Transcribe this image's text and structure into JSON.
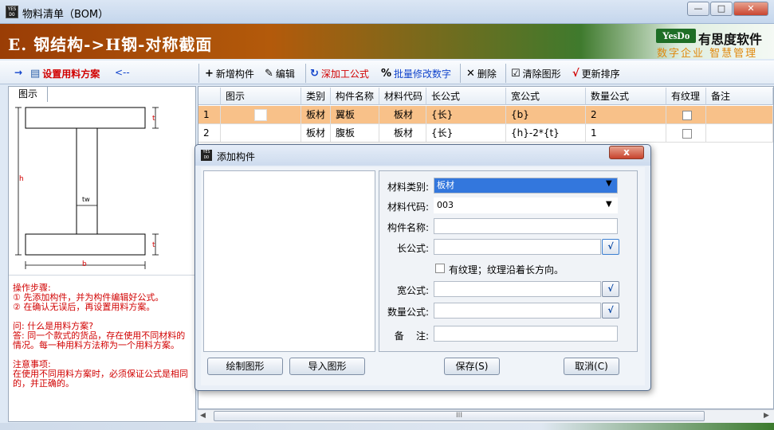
{
  "window": {
    "title": "物料清单（BOM）",
    "icon_text": "YES DO"
  },
  "banner": {
    "title": "E. 钢结构->H钢-对称截面",
    "logo_badge": "YesDo",
    "logo_name": "有思度软件",
    "logo_slogan": "数字企业 智慧管理"
  },
  "toolbar": {
    "arrow_left": "→",
    "setup_plan": "设置用料方案",
    "arrow_back": "<--",
    "add_component": "新增构件",
    "edit": "编辑",
    "add_process_formula": "深加工公式",
    "batch_modify": "批量修改数字",
    "delete": "删除",
    "clear_drawing": "清除图形",
    "reorder": "更新排序"
  },
  "left_panel": {
    "tab": "图示",
    "dim_t": "t",
    "dim_h": "h",
    "dim_tw": "tw",
    "dim_b": "b",
    "steps_title": "操作步骤:",
    "step1": "① 先添加构件，并为构件编辑好公式。",
    "step2": "② 在确认无误后，再设置用料方案。",
    "q_title": "问: 什么是用料方案?",
    "q_answer": "答: 同一个款式的货品，存在使用不同材料的情况。每一种用料方法称为一个用料方案。",
    "note_title": "注意事项:",
    "note_text": "在使用不同用料方案时，必须保证公式是相同的，并正确的。"
  },
  "grid": {
    "headers": [
      "图示",
      "类别",
      "构件名称",
      "材料代码",
      "长公式",
      "宽公式",
      "数量公式",
      "有纹理",
      "备注"
    ],
    "rows": [
      {
        "no": "1",
        "category": "板材",
        "name": "翼板",
        "code": "板材",
        "length": "{长}",
        "width": "{b}",
        "qty": "2"
      },
      {
        "no": "2",
        "category": "板材",
        "name": "腹板",
        "code": "板材",
        "length": "{长}",
        "width": "{h}-2*{t}",
        "qty": "1"
      }
    ],
    "scroll_grip": "III"
  },
  "dialog": {
    "title": "添加构件",
    "close": "x",
    "material_type_label": "材料类别:",
    "material_type_value": "板材",
    "material_code_label": "材料代码:",
    "material_code_value": "003",
    "component_name_label": "构件名称:",
    "component_name_value": "",
    "length_formula_label": "长公式:",
    "length_formula_value": "",
    "grain_label": "有纹理；纹理沿着长方向。",
    "width_formula_label": "宽公式:",
    "width_formula_value": "",
    "qty_formula_label": "数量公式:",
    "qty_formula_value": "",
    "note_label": "备    注:",
    "note_value": "",
    "formula_button": "√",
    "draw_button": "绘制图形",
    "import_button": "导入图形",
    "save_button": "保存(S)",
    "cancel_button": "取消(C)"
  },
  "colors": {
    "banner_start": "#9a3d05",
    "banner_mid": "#3f7a2d",
    "row_selected": "#f8c189",
    "steps_text": "#d10000",
    "logo_green": "#1e6e26",
    "slogan_orange": "#e0890f"
  }
}
